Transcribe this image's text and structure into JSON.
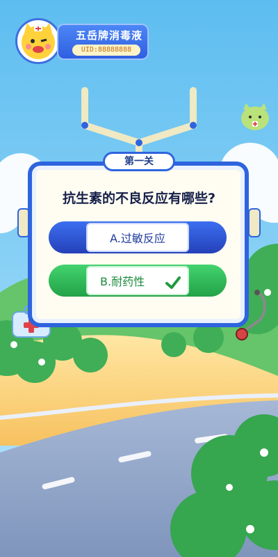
{
  "profile": {
    "name": "五岳牌消毒液",
    "uid": "UID:88888888"
  },
  "quiz": {
    "level": "第一关",
    "question": "抗生素的不良反应有哪些?",
    "options": [
      {
        "label": "A.过敏反应",
        "state": "normal"
      },
      {
        "label": "B.耐药性",
        "state": "correct"
      }
    ]
  },
  "colors": {
    "sky": "#7ccbf2",
    "card_border": "#2e64de",
    "option_blue": "#2e5fe0",
    "option_green": "#2fb859"
  },
  "icons": [
    "check-icon",
    "first-aid-kit-icon",
    "stethoscope-icon",
    "mascot-icon"
  ]
}
